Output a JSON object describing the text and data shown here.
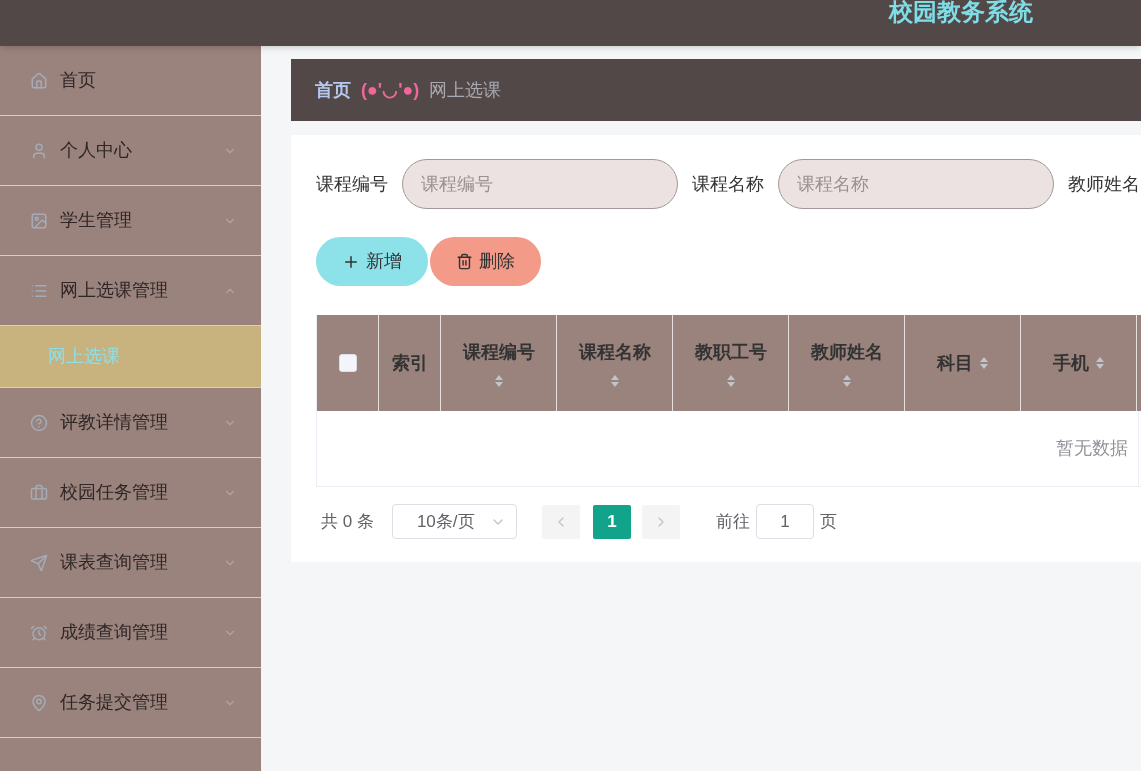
{
  "header": {
    "title": "校园教务系统"
  },
  "sidebar": {
    "items": [
      {
        "label": "首页",
        "kind": "link"
      },
      {
        "label": "个人中心",
        "kind": "menu",
        "expanded": false
      },
      {
        "label": "学生管理",
        "kind": "menu",
        "expanded": false
      },
      {
        "label": "网上选课管理",
        "kind": "menu",
        "expanded": true,
        "children": [
          {
            "label": "网上选课",
            "selected": true
          }
        ]
      },
      {
        "label": "评教详情管理",
        "kind": "menu",
        "expanded": false
      },
      {
        "label": "校园任务管理",
        "kind": "menu",
        "expanded": false
      },
      {
        "label": "课表查询管理",
        "kind": "menu",
        "expanded": false
      },
      {
        "label": "成绩查询管理",
        "kind": "menu",
        "expanded": false
      },
      {
        "label": "任务提交管理",
        "kind": "menu",
        "expanded": false
      }
    ]
  },
  "breadcrumb": {
    "home": "首页",
    "separator": "(●'◡'●)",
    "current": "网上选课"
  },
  "search": [
    {
      "label": "课程编号",
      "placeholder": "课程编号"
    },
    {
      "label": "课程名称",
      "placeholder": "课程名称"
    },
    {
      "label": "教师姓名"
    }
  ],
  "actions": [
    {
      "label": "新增",
      "kind": "add"
    },
    {
      "label": "删除",
      "kind": "delete"
    }
  ],
  "table": {
    "select_all": {
      "checked": false
    },
    "columns": [
      {
        "label": "索引",
        "sortable": false
      },
      {
        "label": "课程编号",
        "sortable": true
      },
      {
        "label": "课程名称",
        "sortable": true
      },
      {
        "label": "教职工号",
        "sortable": true
      },
      {
        "label": "教师姓名",
        "sortable": true
      },
      {
        "label": "科目",
        "sortable": true
      },
      {
        "label": "手机",
        "sortable": true
      }
    ],
    "empty_text": "暂无数据"
  },
  "pagination": {
    "total": "共 0 条",
    "page_size": "10条/页",
    "pages": [
      {
        "label": "1",
        "selected": true
      }
    ],
    "goto_label": "前往",
    "goto_value": "1",
    "goto_suffix": "页"
  }
}
